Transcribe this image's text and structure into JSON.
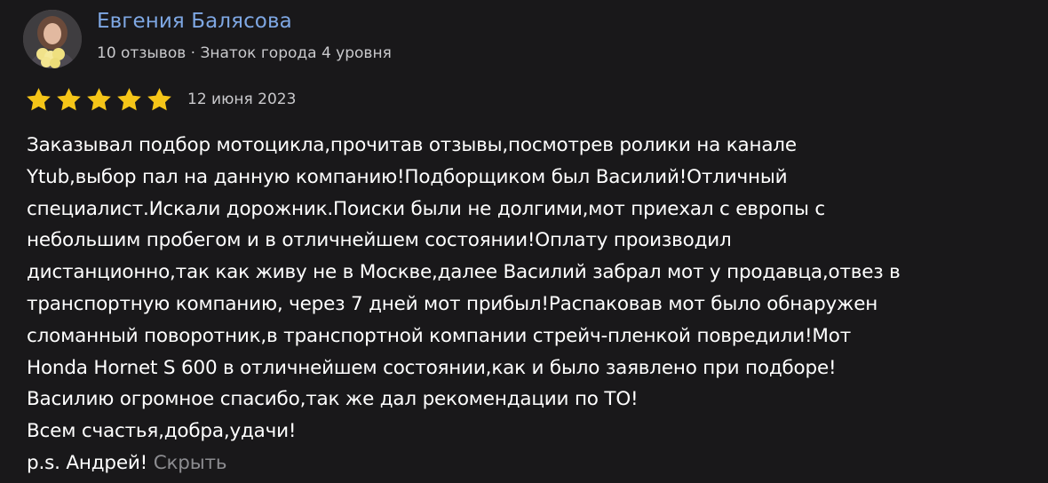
{
  "author": {
    "name": "Евгения Балясова",
    "meta": "10 отзывов · Знаток города 4 уровня"
  },
  "rating": {
    "value": 5,
    "max": 5,
    "star_color": "#f5c518"
  },
  "review": {
    "date": "12 июня 2023",
    "lines": [
      "Заказывал подбор мотоцикла,прочитав отзывы,посмотрев ролики на канале",
      "Ytub,выбор пал на данную компанию!Подборщиком был Василий!Отличный",
      "специалист.Искали дорожник.Поиски были не долгими,мот приехал с европы с",
      "небольшим пробегом и в отличнейшем состоянии!Оплату производил",
      "дистанционно,так как живу не в Москве,далее Василий забрал мот у продавца,отвез в",
      "транспортную компанию, через 7 дней мот прибыл!Распаковав мот было обнаружен",
      "сломанный поворотник,в транспортной компании стрейч-пленкой повредили!Мот",
      "Honda Hornet S 600 в отличнейшем состоянии,как и было заявлено при подборе!",
      "Василию огромное спасибо,так же дал рекомендации по ТО!",
      "Всем счастья,добра,удачи!",
      "p.s. Андрей!"
    ],
    "hide_label": "Скрыть"
  },
  "colors": {
    "background": "#19181a",
    "author_link": "#7ea7e3",
    "meta_text": "#c9c9cc",
    "muted_link": "#8c8c90"
  },
  "icons": {
    "avatar": "user-photo-avatar",
    "star": "star-icon"
  }
}
